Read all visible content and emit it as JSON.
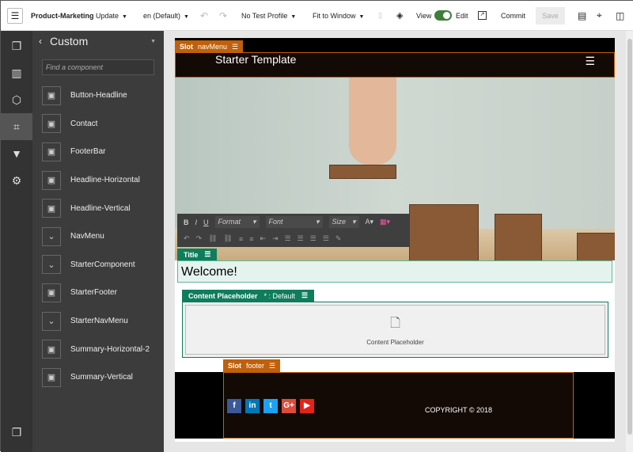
{
  "topbar": {
    "site": "Product-Marketing",
    "update": "Update",
    "language": "en (Default)",
    "test_profile": "No Test Profile",
    "fit": "Fit to Window",
    "view": "View",
    "edit": "Edit",
    "commit": "Commit",
    "save": "Save"
  },
  "panel": {
    "title": "Custom",
    "search_placeholder": "Find a component",
    "components": [
      {
        "label": "Button-Headline",
        "icon": "layout-icon"
      },
      {
        "label": "Contact",
        "icon": "layout-icon"
      },
      {
        "label": "FooterBar",
        "icon": "layout-icon"
      },
      {
        "label": "Headline-Horizontal",
        "icon": "layout-icon"
      },
      {
        "label": "Headline-Vertical",
        "icon": "layout-icon"
      },
      {
        "label": "NavMenu",
        "icon": "chevron-circle-icon"
      },
      {
        "label": "StarterComponent",
        "icon": "chevron-circle-icon"
      },
      {
        "label": "StarterFooter",
        "icon": "layout-icon"
      },
      {
        "label": "StarterNavMenu",
        "icon": "chevron-circle-icon"
      },
      {
        "label": "Summary-Horizontal-2",
        "icon": "layout-icon"
      },
      {
        "label": "Summary-Vertical",
        "icon": "layout-icon"
      }
    ]
  },
  "page": {
    "nav_slot": {
      "label": "Slot",
      "name": "navMenu"
    },
    "site_title": "Starter Template",
    "rte": {
      "format": "Format",
      "font": "Font",
      "size": "Size"
    },
    "title_tab": "Title",
    "welcome": "Welcome!",
    "content_tab": {
      "label": "Content Placeholder",
      "variant": "* : Default"
    },
    "content_text": "Content Placeholder",
    "footer_slot": {
      "label": "Slot",
      "name": "footer"
    },
    "copyright": "COPYRIGHT © 2018"
  },
  "colors": {
    "slot": "#c0600b",
    "component": "#0e7d5c"
  }
}
